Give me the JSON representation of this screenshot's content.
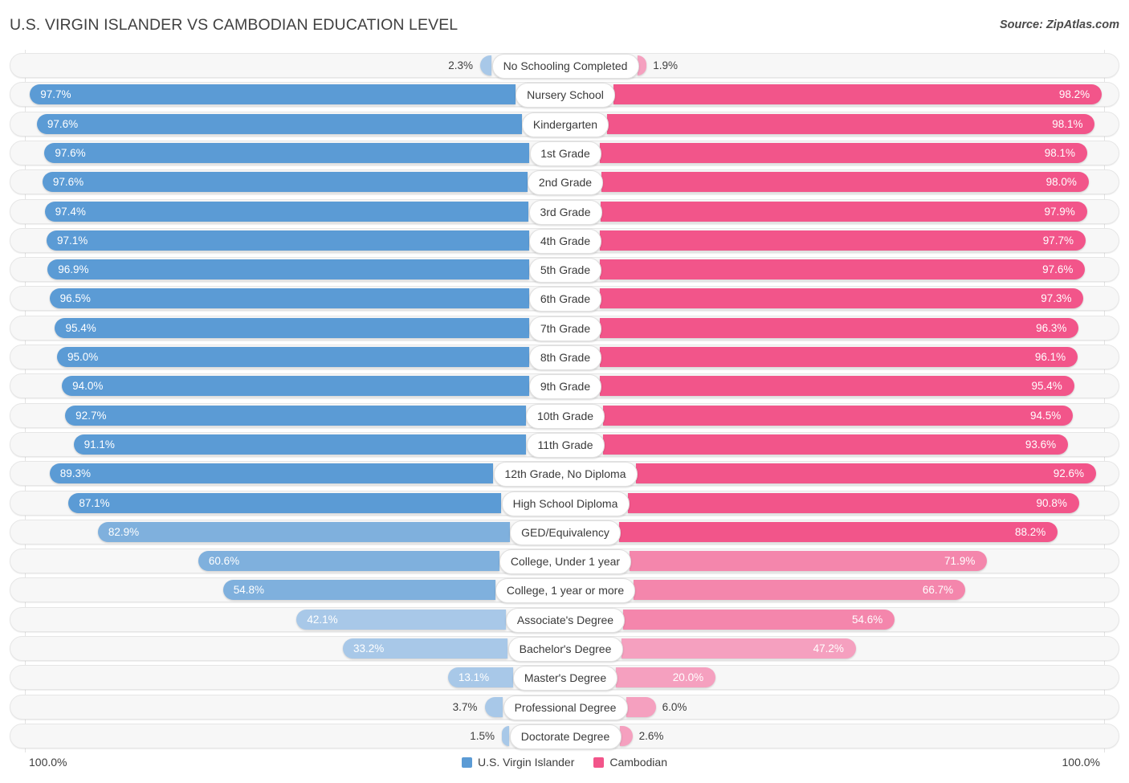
{
  "header": {
    "title": "U.S. VIRGIN ISLANDER VS CAMBODIAN EDUCATION LEVEL",
    "source": "Source: ZipAtlas.com"
  },
  "axis": {
    "left_end": "100.0%",
    "right_end": "100.0%"
  },
  "legend": {
    "items": [
      {
        "label": "U.S. Virgin Islander",
        "color": "#5b9bd5"
      },
      {
        "label": "Cambodian",
        "color": "#f2558a"
      }
    ]
  },
  "colors": {
    "blue_strong": "#5b9bd5",
    "blue_mid": "#7fb0dd",
    "blue_light": "#a8c8e8",
    "pink_strong": "#f2558a",
    "pink_mid": "#f486ac",
    "pink_light": "#f5a0bf",
    "track_bg": "#f7f7f7",
    "gridline": "#e3e3e3"
  },
  "chart_data": {
    "type": "bar",
    "orientation": "horizontal-diverging",
    "title": "U.S. Virgin Islander vs Cambodian Education Level",
    "xlabel": "",
    "ylabel": "",
    "xlim": [
      0,
      100
    ],
    "grid": true,
    "legend_position": "bottom-center",
    "categories": [
      "No Schooling Completed",
      "Nursery School",
      "Kindergarten",
      "1st Grade",
      "2nd Grade",
      "3rd Grade",
      "4th Grade",
      "5th Grade",
      "6th Grade",
      "7th Grade",
      "8th Grade",
      "9th Grade",
      "10th Grade",
      "11th Grade",
      "12th Grade, No Diploma",
      "High School Diploma",
      "GED/Equivalency",
      "College, Under 1 year",
      "College, 1 year or more",
      "Associate's Degree",
      "Bachelor's Degree",
      "Master's Degree",
      "Professional Degree",
      "Doctorate Degree"
    ],
    "series": [
      {
        "name": "U.S. Virgin Islander",
        "color": "#5b9bd5",
        "values": [
          2.3,
          97.7,
          97.6,
          97.6,
          97.6,
          97.4,
          97.1,
          96.9,
          96.5,
          95.4,
          95.0,
          94.0,
          92.7,
          91.1,
          89.3,
          87.1,
          82.9,
          60.6,
          54.8,
          42.1,
          33.2,
          13.1,
          3.7,
          1.5
        ],
        "labels": [
          "2.3%",
          "97.7%",
          "97.6%",
          "97.6%",
          "97.6%",
          "97.4%",
          "97.1%",
          "96.9%",
          "96.5%",
          "95.4%",
          "95.0%",
          "94.0%",
          "92.7%",
          "91.1%",
          "89.3%",
          "87.1%",
          "82.9%",
          "60.6%",
          "54.8%",
          "42.1%",
          "33.2%",
          "13.1%",
          "3.7%",
          "1.5%"
        ]
      },
      {
        "name": "Cambodian",
        "color": "#f2558a",
        "values": [
          1.9,
          98.2,
          98.1,
          98.1,
          98.0,
          97.9,
          97.7,
          97.6,
          97.3,
          96.3,
          96.1,
          95.4,
          94.5,
          93.6,
          92.6,
          90.8,
          88.2,
          71.9,
          66.7,
          54.6,
          47.2,
          20.0,
          6.0,
          2.6
        ],
        "labels": [
          "1.9%",
          "98.2%",
          "98.1%",
          "98.1%",
          "98.0%",
          "97.9%",
          "97.7%",
          "97.6%",
          "97.3%",
          "96.3%",
          "96.1%",
          "95.4%",
          "94.5%",
          "93.6%",
          "92.6%",
          "90.8%",
          "88.2%",
          "71.9%",
          "66.7%",
          "54.6%",
          "47.2%",
          "20.0%",
          "6.0%",
          "2.6%"
        ]
      }
    ]
  }
}
